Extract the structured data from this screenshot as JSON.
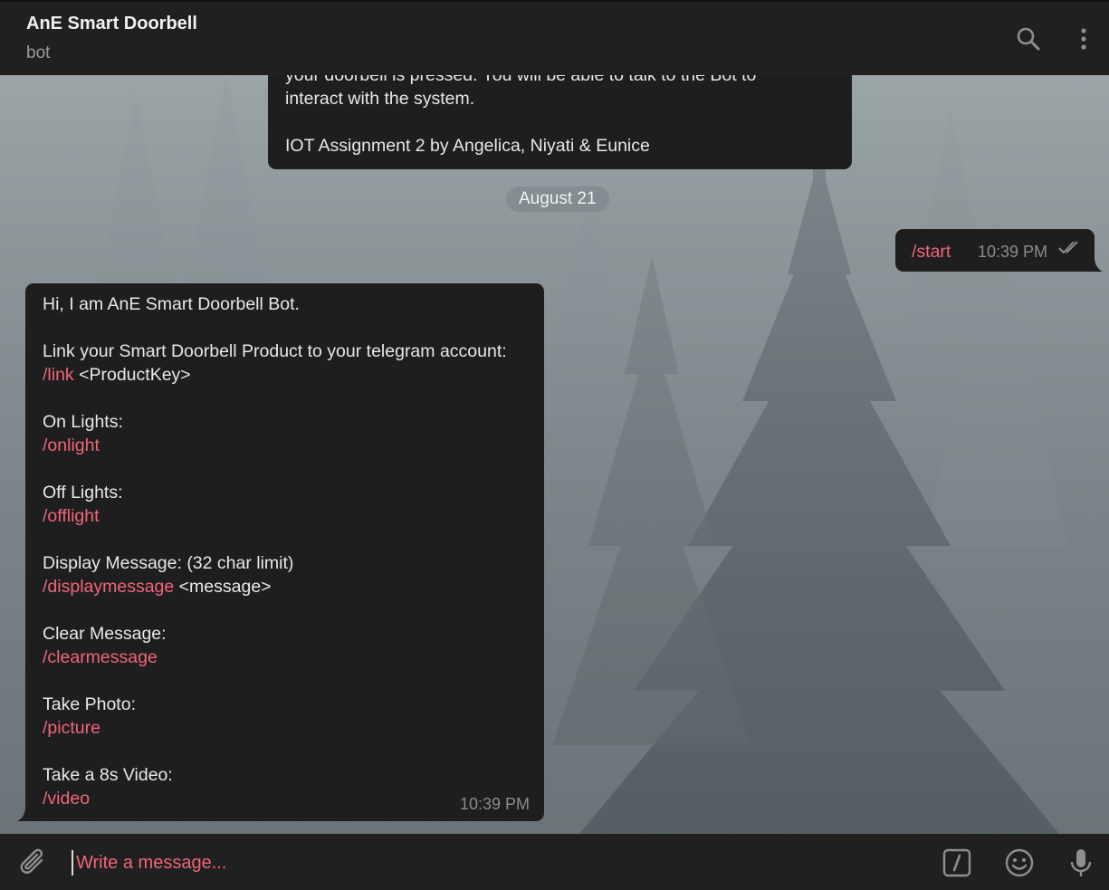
{
  "header": {
    "title": "AnE Smart Doorbell",
    "subtitle": "bot",
    "icons": [
      "search-icon",
      "more-vertical-icon"
    ]
  },
  "messages": {
    "intro": {
      "line1": "your doorbell is pressed. You will be able to talk to the Bot to",
      "line2": "interact with the system.",
      "line3": "IOT Assignment 2 by Angelica, Niyati & Eunice"
    },
    "date_label": "August 21",
    "outgoing": {
      "text": "/start",
      "time": "10:39 PM",
      "status_icon": "double-check-icon"
    },
    "incoming": {
      "greeting": "Hi, I am AnE Smart Doorbell Bot.",
      "link_label": "Link your Smart Doorbell Product to your telegram account:",
      "link_cmd": "/link",
      "link_arg": " <ProductKey>",
      "on_label": "On Lights:",
      "on_cmd": "/onlight",
      "off_label": "Off Lights:",
      "off_cmd": "/offlight",
      "display_label": "Display Message: (32 char limit)",
      "display_cmd": "/displaymessage",
      "display_arg": " <message>",
      "clear_label": "Clear Message:",
      "clear_cmd": "/clearmessage",
      "photo_label": "Take Photo:",
      "photo_cmd": "/picture",
      "video_label": "Take a 8s Video:",
      "video_cmd": "/video",
      "time": "10:39 PM"
    }
  },
  "input": {
    "placeholder": "Write a message...",
    "icons": [
      "paperclip-icon",
      "bot-command-icon",
      "emoji-icon",
      "microphone-icon"
    ]
  },
  "colors": {
    "accent": "#f0657a",
    "bubble": "#1e1e1f",
    "header": "#202020"
  }
}
